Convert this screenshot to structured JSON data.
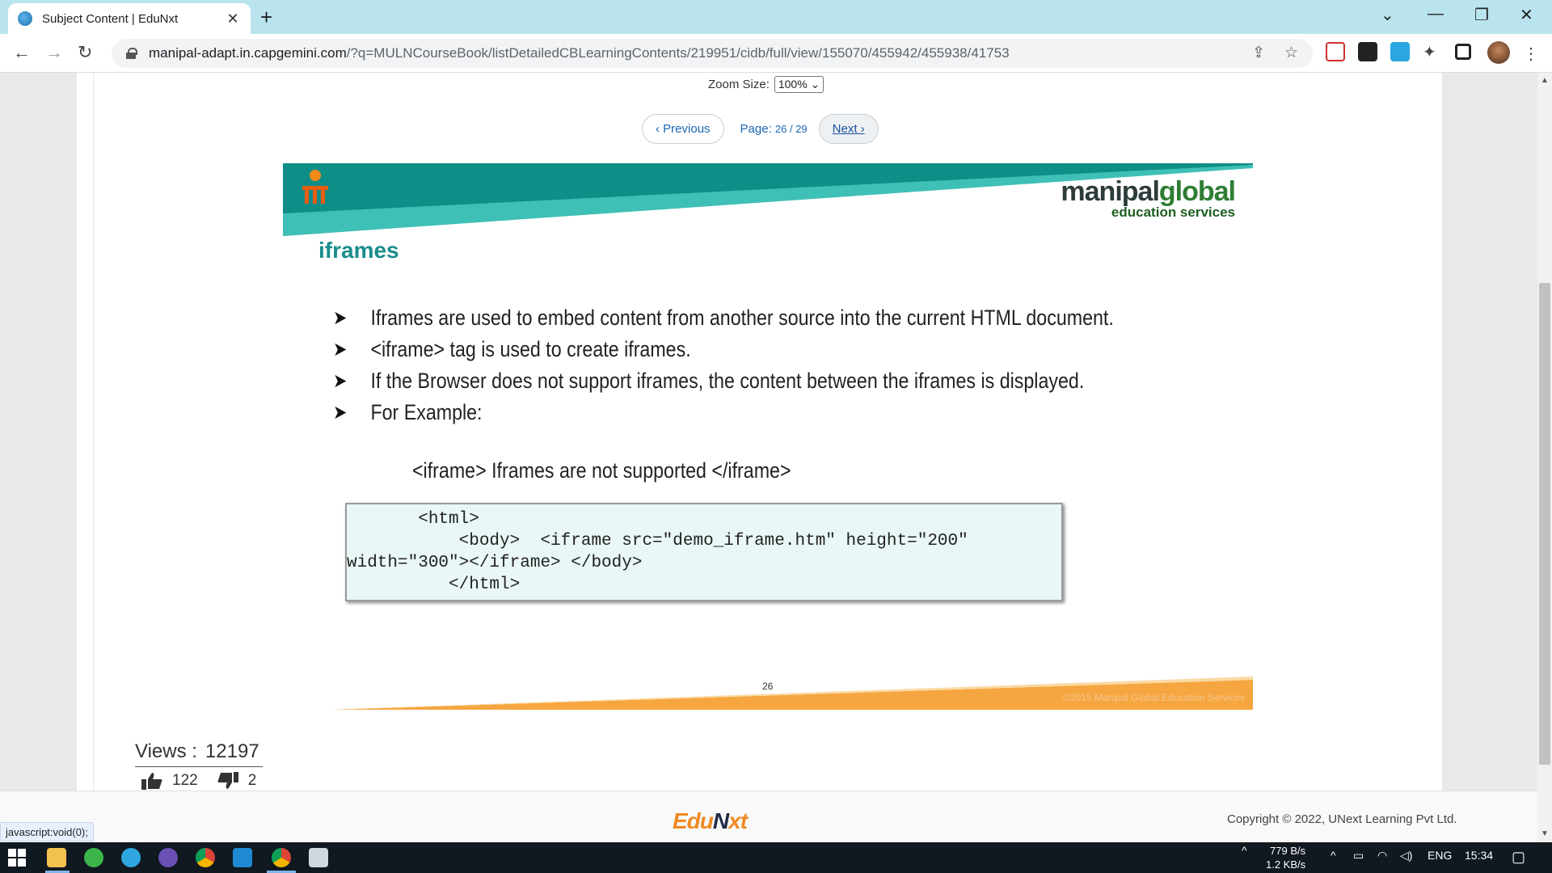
{
  "browser": {
    "tab_title": "Subject Content | EduNxt",
    "url_host": "manipal-adapt.in.capgemini.com",
    "url_path": "/?q=MULNCourseBook/listDetailedCBLearningContents/219951/cidb/full/view/155070/455942/455938/41753",
    "status_text": "javascript:void(0);"
  },
  "viewer": {
    "zoom_label": "Zoom Size:",
    "zoom_value": "100%",
    "prev_label": "Previous",
    "page_label": "Page:",
    "page_value": "26 / 29",
    "next_label": "Next"
  },
  "slide": {
    "brand_main_a": "manipal",
    "brand_main_b": "global",
    "brand_sub": "education services",
    "title": "iframes",
    "bullets": [
      "Iframes are used to embed content from another source into the current HTML document.",
      "<iframe> tag is used to create iframes.",
      "If the Browser does not support iframes, the content between the iframes is displayed.",
      "For Example:"
    ],
    "example": "<iframe>  Iframes are not supported </iframe>",
    "code_lines": [
      "       <html>",
      "           <body>  <iframe src=\"demo_iframe.htm\" height=\"200\"",
      "width=\"300\"></iframe> </body>",
      "          </html>"
    ],
    "page_number": "26",
    "copyright": "©2015 Manipal Global Education Services"
  },
  "stats": {
    "views_label": "Views :",
    "views_value": "12197",
    "likes": "122",
    "dislikes": "2"
  },
  "footer": {
    "logo_a": "Edu",
    "logo_n": "N",
    "logo_b": "xt",
    "copyright": "Copyright © 2022, UNext Learning Pvt Ltd."
  },
  "taskbar": {
    "net_up": "779 B/s",
    "net_down": "1.2 KB/s",
    "lang": "ENG",
    "time": "15:34"
  },
  "colors": {
    "teal": "#1a8c8c",
    "orange": "#f5a640",
    "link": "#1a66b3"
  }
}
